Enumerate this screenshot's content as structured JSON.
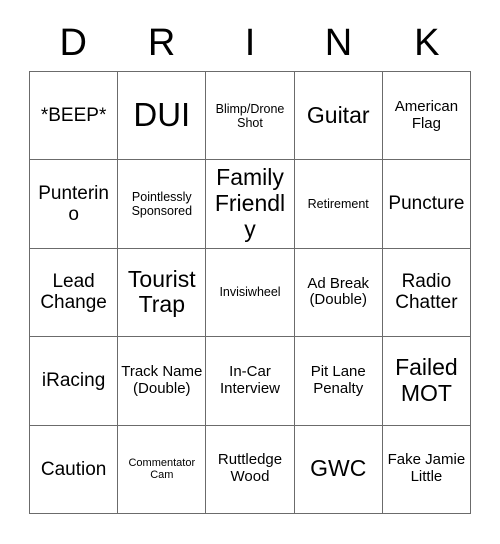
{
  "card": {
    "header_letters": [
      "D",
      "R",
      "I",
      "N",
      "K"
    ],
    "rows": [
      [
        {
          "text": "*BEEP*",
          "size": "fs-md"
        },
        {
          "text": "DUI",
          "size": "fs-xl"
        },
        {
          "text": "Blimp/Drone Shot",
          "size": "fs-xs"
        },
        {
          "text": "Guitar",
          "size": "fs-lg"
        },
        {
          "text": "American Flag",
          "size": "fs-sm"
        }
      ],
      [
        {
          "text": "Punterino",
          "size": "fs-md"
        },
        {
          "text": "Pointlessly Sponsored",
          "size": "fs-xs"
        },
        {
          "text": "Family Friendly",
          "size": "fs-lg"
        },
        {
          "text": "Retirement",
          "size": "fs-xs"
        },
        {
          "text": "Puncture",
          "size": "fs-md"
        }
      ],
      [
        {
          "text": "Lead Change",
          "size": "fs-md"
        },
        {
          "text": "Tourist Trap",
          "size": "fs-lg"
        },
        {
          "text": "Invisiwheel",
          "size": "fs-xs"
        },
        {
          "text": "Ad Break (Double)",
          "size": "fs-sm"
        },
        {
          "text": "Radio Chatter",
          "size": "fs-md"
        }
      ],
      [
        {
          "text": "iRacing",
          "size": "fs-md"
        },
        {
          "text": "Track Name (Double)",
          "size": "fs-sm"
        },
        {
          "text": "In-Car Interview",
          "size": "fs-sm"
        },
        {
          "text": "Pit Lane Penalty",
          "size": "fs-sm"
        },
        {
          "text": "Failed MOT",
          "size": "fs-lg"
        }
      ],
      [
        {
          "text": "Caution",
          "size": "fs-md"
        },
        {
          "text": "Commentator Cam",
          "size": "fs-xxs"
        },
        {
          "text": "Ruttledge Wood",
          "size": "fs-sm"
        },
        {
          "text": "GWC",
          "size": "fs-lg"
        },
        {
          "text": "Fake Jamie Little",
          "size": "fs-sm"
        }
      ]
    ]
  }
}
